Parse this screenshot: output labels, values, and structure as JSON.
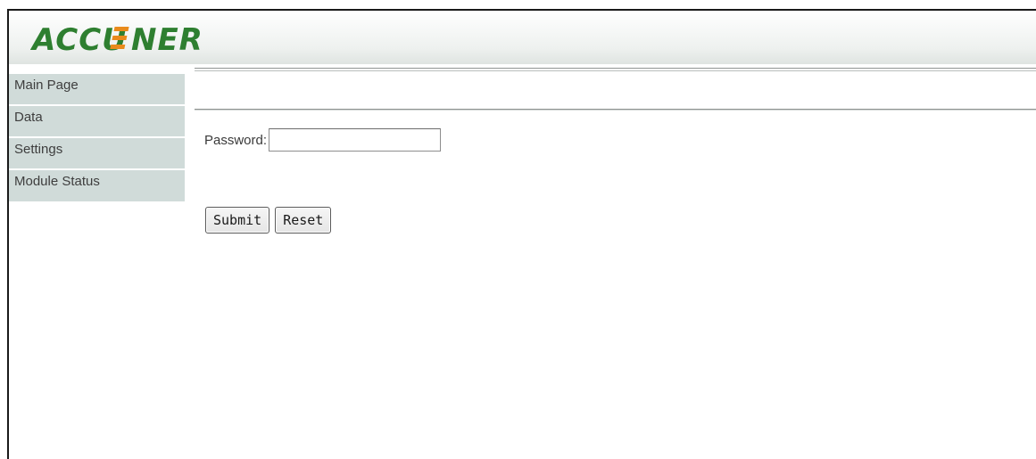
{
  "header": {
    "logo_text": "ACCUENERGY"
  },
  "sidebar": {
    "items": [
      {
        "label": "Main Page"
      },
      {
        "label": "Data"
      },
      {
        "label": "Settings"
      },
      {
        "label": "Module Status"
      }
    ]
  },
  "form": {
    "password_label": "Password:",
    "password_value": "",
    "submit_label": "Submit",
    "reset_label": "Reset"
  },
  "colors": {
    "logo_green": "#2e7f30",
    "logo_accent": "#e98a1b",
    "sidebar_bg": "#d0dbd9"
  }
}
